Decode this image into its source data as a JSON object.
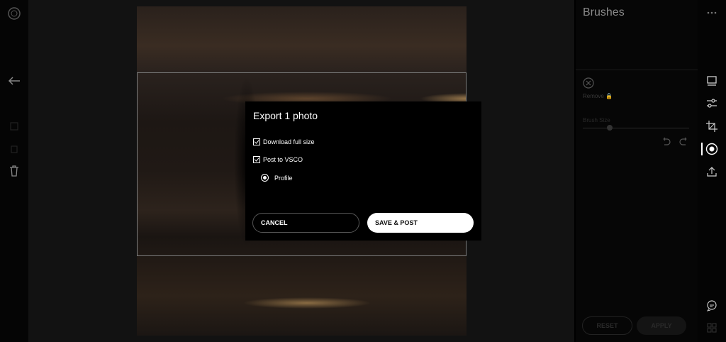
{
  "panel": {
    "title": "Brushes",
    "remove_label": "Remove",
    "brush_size_label": "Brush Size",
    "reset_label": "RESET",
    "apply_label": "APPLY"
  },
  "dialog": {
    "title": "Export 1 photo",
    "options": [
      {
        "label": "Download full size",
        "checked": true
      },
      {
        "label": "Post to VSCO",
        "checked": true
      }
    ],
    "radio": {
      "label": "Profile",
      "selected": true
    },
    "cancel_label": "CANCEL",
    "save_label": "SAVE & POST"
  },
  "icons": {
    "left_rail": [
      "logo-icon",
      "back-arrow-icon",
      "copy-icon",
      "paste-icon",
      "trash-icon"
    ],
    "right_rail": [
      "more-icon",
      "presets-icon",
      "adjust-icon",
      "crop-icon",
      "brushes-icon",
      "export-icon",
      "feedback-icon",
      "grid-icon"
    ]
  },
  "colors": {
    "background": "#000000",
    "button_primary": "#ffffff",
    "panel": "#060606"
  }
}
